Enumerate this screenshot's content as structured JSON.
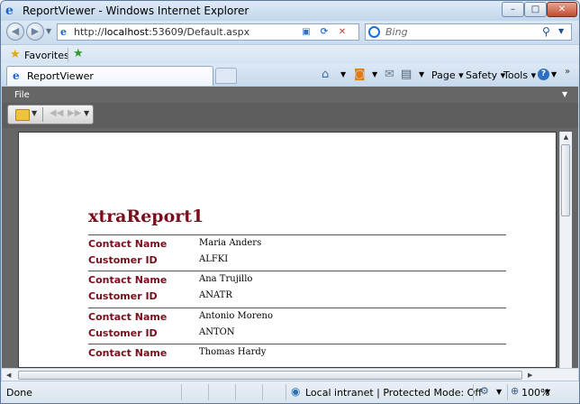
{
  "window": {
    "title": "ReportViewer - Windows Internet Explorer",
    "minimize": "–",
    "maximize": "□",
    "close": "✕"
  },
  "navigation": {
    "back": "◀",
    "forward": "▶",
    "url_prefix": "http://",
    "url_host": "localhost",
    "url_rest": ":53609/Default.aspx",
    "search_placeholder": "Bing"
  },
  "favorites_bar": {
    "label": "Favorites"
  },
  "tabs": [
    {
      "label": "ReportViewer",
      "active": true
    }
  ],
  "command_bar": {
    "page": "Page ▾",
    "safety": "Safety ▾",
    "tools": "Tools ▾",
    "help": "?",
    "more": "»"
  },
  "report_viewer": {
    "menu": {
      "file": "File"
    }
  },
  "report": {
    "title": "xtraReport1",
    "records": [
      {
        "contact_label": "Contact Name",
        "contact_value": "Maria Anders",
        "id_label": "Customer ID",
        "id_value": "ALFKI"
      },
      {
        "contact_label": "Contact Name",
        "contact_value": "Ana Trujillo",
        "id_label": "Customer ID",
        "id_value": "ANATR"
      },
      {
        "contact_label": "Contact Name",
        "contact_value": "Antonio Moreno",
        "id_label": "Customer ID",
        "id_value": "ANTON"
      },
      {
        "contact_label": "Contact Name",
        "contact_value": "Thomas Hardy"
      }
    ]
  },
  "status_bar": {
    "status": "Done",
    "zone": "Local intranet | Protected Mode: Off",
    "zoom": "100%"
  },
  "colors": {
    "report_title": "#7b0e1c",
    "report_label": "#7b0e1c",
    "viewer_toolbar": "#666666",
    "frame": "#bcd3ea"
  }
}
